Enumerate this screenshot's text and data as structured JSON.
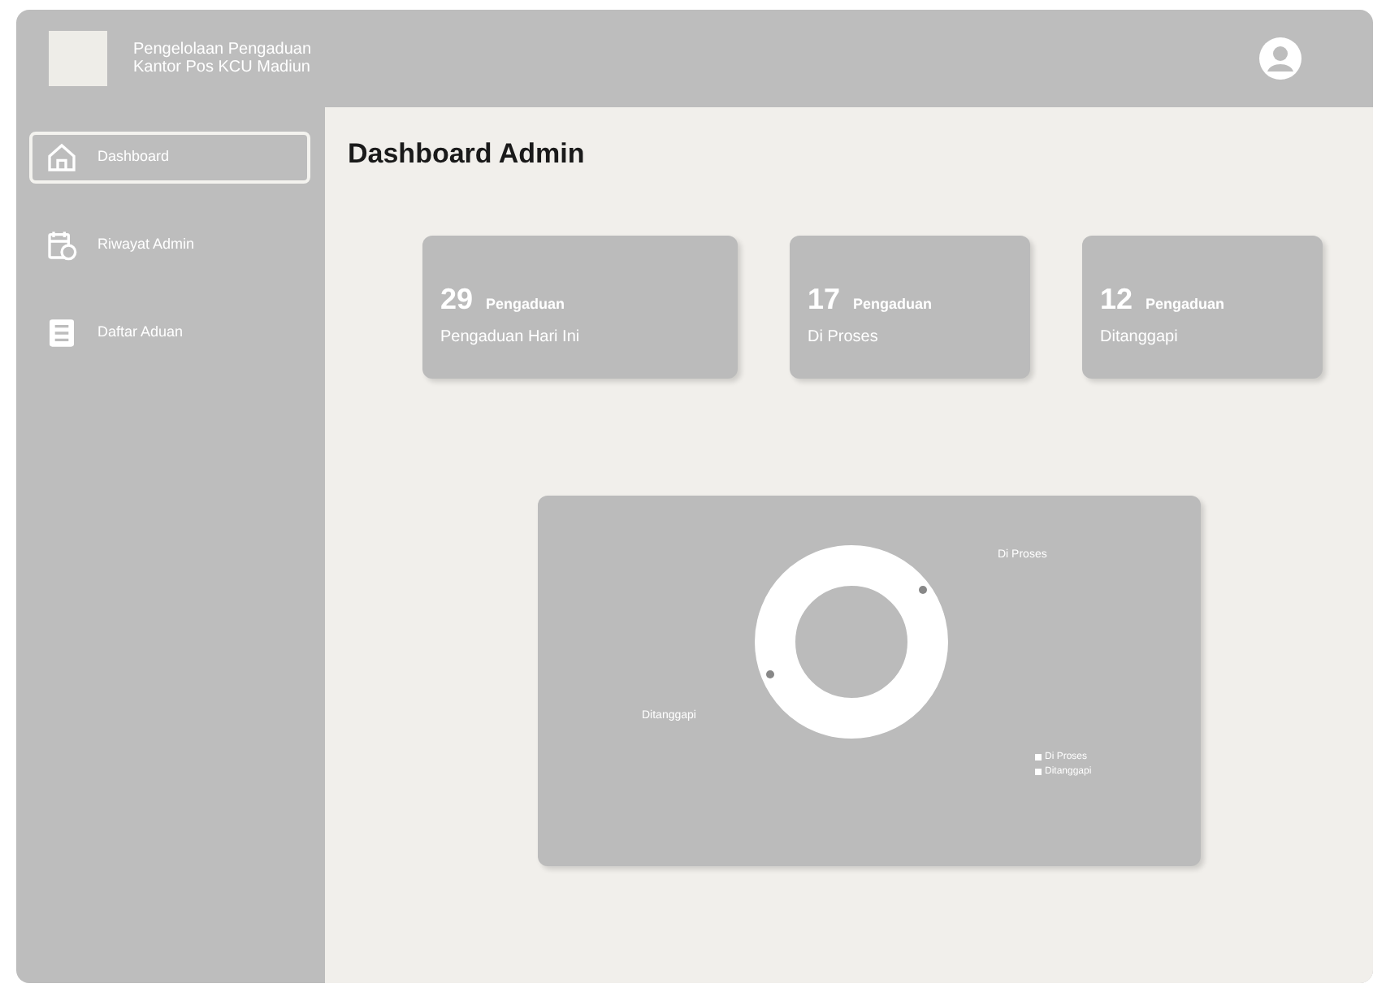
{
  "header": {
    "title_lines": [
      "Pengelolaan Pengaduan",
      "Kantor Pos KCU Madiun"
    ]
  },
  "sidebar": {
    "items": [
      {
        "label": "Dashboard",
        "kind": "home",
        "selected": true
      },
      {
        "label": "Riwayat Admin",
        "kind": "calendar",
        "selected": false
      },
      {
        "label": "Daftar Aduan",
        "kind": "list",
        "selected": false
      }
    ]
  },
  "page_title": "Dashboard Admin",
  "stat_cards": [
    {
      "number": "29",
      "unit": "Pengaduan",
      "caption": "Pengaduan Hari Ini"
    },
    {
      "number": "17",
      "unit": "Pengaduan",
      "caption": "Di Proses"
    },
    {
      "number": "12",
      "unit": "Pengaduan",
      "caption": "Ditanggapi"
    }
  ],
  "chart_panel": {
    "label_right": "Di Proses",
    "label_left": "Ditanggapi",
    "legend": [
      "Di Proses",
      "Ditanggapi"
    ]
  }
}
